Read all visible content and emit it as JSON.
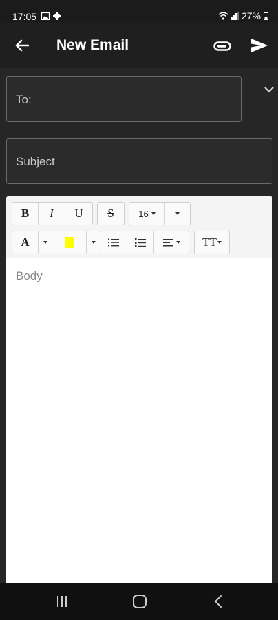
{
  "status_bar": {
    "time": "17:05",
    "battery": "27%"
  },
  "app_bar": {
    "title": "New Email"
  },
  "compose": {
    "to_placeholder": "To:",
    "subject_placeholder": "Subject",
    "body_placeholder": "Body"
  },
  "toolbar": {
    "bold": "B",
    "italic": "I",
    "underline": "U",
    "strikethrough": "S",
    "font_size": "16",
    "text_color": "A",
    "highlight_color": "#ffff00",
    "text_style": "TT"
  }
}
